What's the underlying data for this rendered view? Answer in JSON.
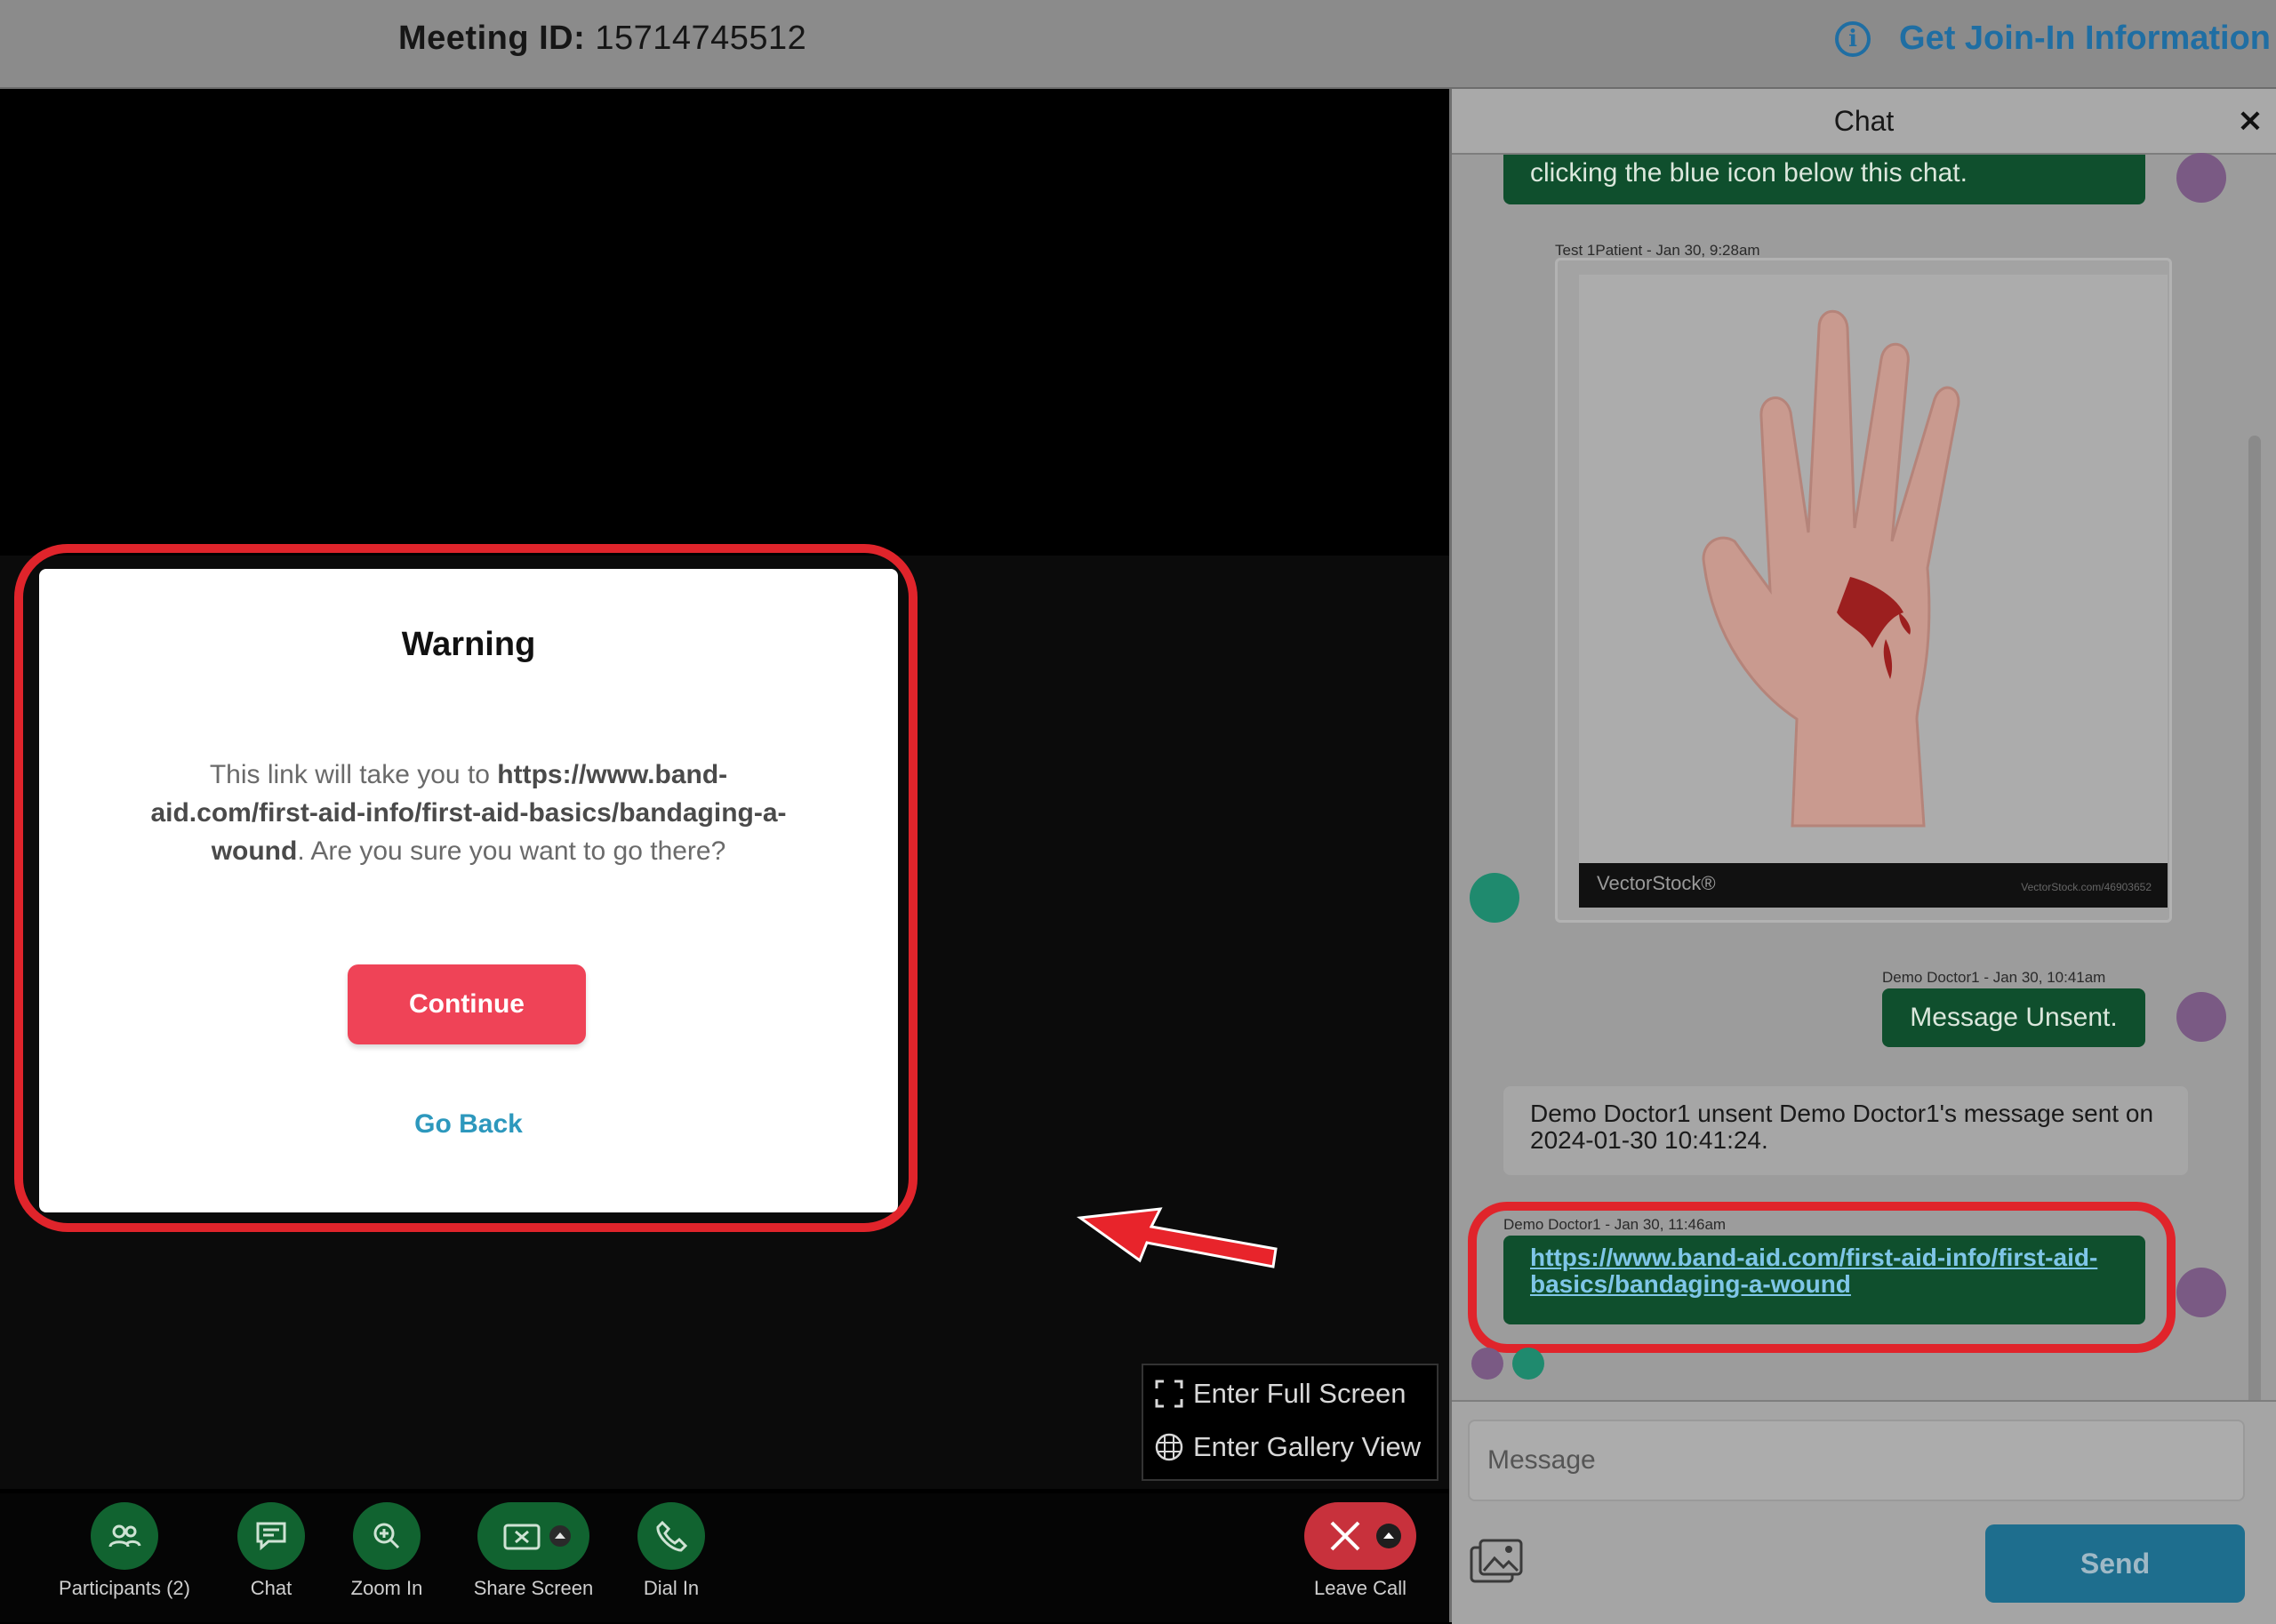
{
  "topbar": {
    "meeting_label": "Meeting ID:",
    "meeting_id": "15714745512",
    "join_info": "Get Join-In Information"
  },
  "modal": {
    "title": "Warning",
    "text_before": "This link will take you to ",
    "url": "https://www.band-aid.com/first-aid-info/first-aid-basics/bandaging-a-wound",
    "text_after": ". Are you sure you want to go there?",
    "continue_label": "Continue",
    "goback_label": "Go Back"
  },
  "view_options": {
    "fullscreen": "Enter Full Screen",
    "gallery": "Enter Gallery View"
  },
  "toolbar": {
    "participants": "Participants (2)",
    "chat": "Chat",
    "zoom": "Zoom In",
    "share": "Share Screen",
    "dial": "Dial In",
    "leave": "Leave Call"
  },
  "chat": {
    "title": "Chat",
    "close": "×",
    "messages": [
      {
        "text": "clicking the blue icon below this chat."
      },
      {
        "meta": "Test 1Patient - Jan 30, 9:28am",
        "image_brand": "VectorStock®",
        "image_url": "VectorStock.com/46903652"
      },
      {
        "meta": "Demo Doctor1 - Jan 30, 10:41am",
        "text": "Message Unsent."
      },
      {
        "text": "Demo Doctor1 unsent Demo Doctor1's message sent on 2024-01-30 10:41:24."
      },
      {
        "meta": "Demo Doctor1 - Jan 30, 11:46am",
        "text": "https://www.band-aid.com/first-aid-info/first-aid-basics/bandaging-a-wound"
      }
    ],
    "input_placeholder": "Message",
    "send_label": "Send"
  },
  "colors": {
    "accent_green": "#0f4f2d",
    "warning_red": "#e0242b",
    "continue_red": "#ef4357",
    "link_blue": "#2d98bd"
  }
}
